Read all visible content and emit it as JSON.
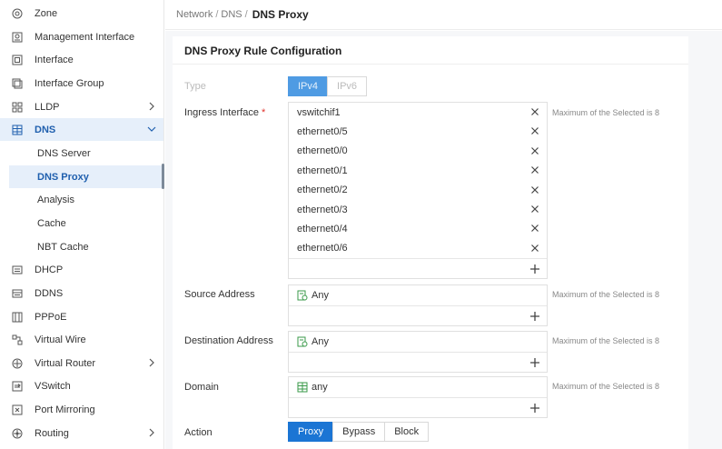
{
  "sidebar": {
    "items": [
      {
        "label": "Zone",
        "icon": "zone-icon"
      },
      {
        "label": "Management Interface",
        "icon": "management-interface-icon"
      },
      {
        "label": "Interface",
        "icon": "interface-icon"
      },
      {
        "label": "Interface Group",
        "icon": "interface-group-icon"
      },
      {
        "label": "LLDP",
        "icon": "lldp-icon"
      },
      {
        "label": "DNS",
        "icon": "dns-icon"
      },
      {
        "label": "DHCP",
        "icon": "dhcp-icon"
      },
      {
        "label": "DDNS",
        "icon": "ddns-icon"
      },
      {
        "label": "PPPoE",
        "icon": "pppoe-icon"
      },
      {
        "label": "Virtual Wire",
        "icon": "virtual-wire-icon"
      },
      {
        "label": "Virtual Router",
        "icon": "virtual-router-icon"
      },
      {
        "label": "VSwitch",
        "icon": "vswitch-icon"
      },
      {
        "label": "Port Mirroring",
        "icon": "port-mirroring-icon"
      },
      {
        "label": "Routing",
        "icon": "routing-icon"
      }
    ],
    "dns_sub": [
      "DNS Server",
      "DNS Proxy",
      "Analysis",
      "Cache",
      "NBT Cache"
    ]
  },
  "breadcrumb": {
    "part1": "Network",
    "sep": "/",
    "part2": "DNS",
    "current": "DNS Proxy"
  },
  "panel": {
    "title": "DNS Proxy Rule Configuration"
  },
  "form": {
    "type_label": "Type",
    "type_options": [
      "IPv4",
      "IPv6"
    ],
    "ingress_label": "Ingress Interface",
    "required_mark": "*",
    "ingress_items": [
      "vswitchif1",
      "ethernet0/5",
      "ethernet0/0",
      "ethernet0/1",
      "ethernet0/2",
      "ethernet0/3",
      "ethernet0/4",
      "ethernet0/6"
    ],
    "hint": "Maximum of the Selected is 8",
    "source_label": "Source Address",
    "source_value": "Any",
    "destination_label": "Destination Address",
    "destination_value": "Any",
    "domain_label": "Domain",
    "domain_value": "any",
    "action_label": "Action",
    "action_options": [
      "Proxy",
      "Bypass",
      "Block"
    ]
  },
  "colors": {
    "accent": "#1b75d4",
    "active_bg": "#e6effa",
    "active_text": "#1f5fae"
  }
}
